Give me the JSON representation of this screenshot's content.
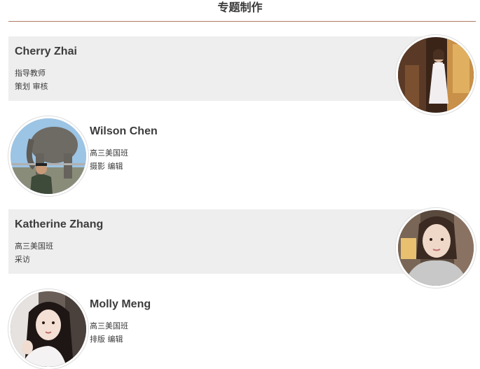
{
  "page": {
    "title": "专题制作"
  },
  "members": [
    {
      "name": "Cherry Zhai",
      "line1": "指导教师",
      "line2": "策划 审核"
    },
    {
      "name": "Wilson Chen",
      "line1": "高三美国班",
      "line2": "摄影 编辑"
    },
    {
      "name": "Katherine Zhang",
      "line1": "高三美国班",
      "line2": "采访"
    },
    {
      "name": "Molly Meng",
      "line1": "高三美国班",
      "line2": "排版 编辑"
    }
  ]
}
